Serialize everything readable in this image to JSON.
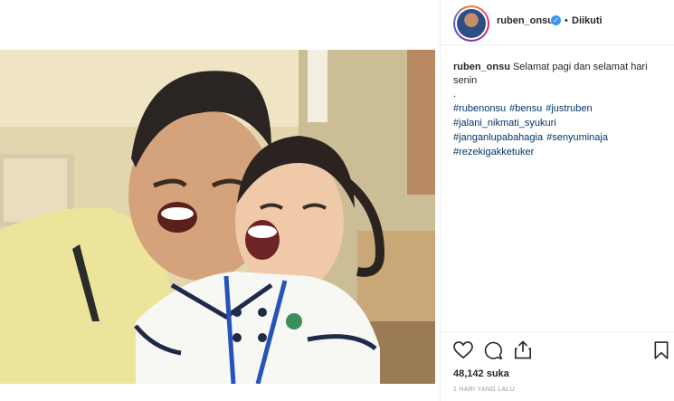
{
  "header": {
    "username": "ruben_onsu",
    "verified_mark": "✓",
    "separator": "•",
    "follow_status": "Diikuti"
  },
  "caption": {
    "username": "ruben_onsu",
    "text_line1": "Selamat pagi dan selamat hari",
    "text_line2": "senin",
    "spacer": "."
  },
  "hashtags": [
    "#rubenonsu",
    "#bensu",
    "#justruben",
    "#jalani_nikmati_syukuri",
    "#janganlupabahagia",
    "#senyuminaja",
    "#rezekigakketuker"
  ],
  "actions": {
    "like_icon": "heart-icon",
    "comment_icon": "comment-icon",
    "share_icon": "share-icon",
    "save_icon": "bookmark-icon"
  },
  "likes_text": "48,142 suka",
  "timestamp": "1 HARI YANG LALU",
  "colors": {
    "verified": "#3897f0",
    "hashtag": "#003569",
    "muted": "#999999"
  }
}
